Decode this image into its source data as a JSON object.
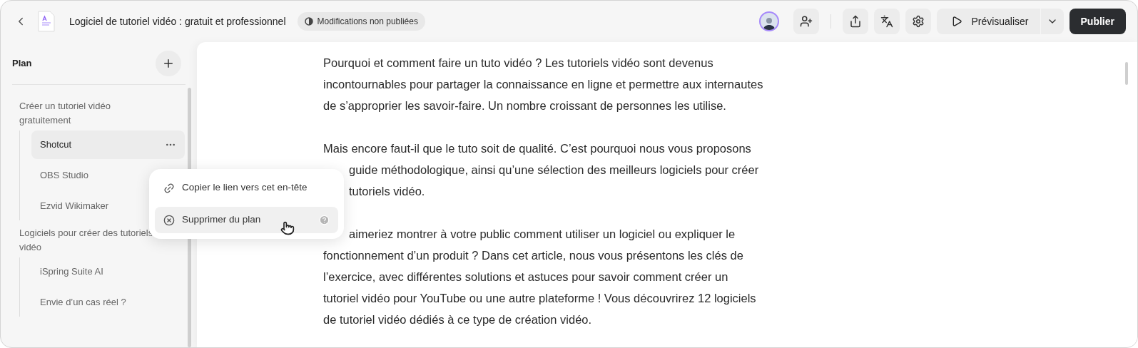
{
  "header": {
    "title": "Logiciel de tutoriel vidéo : gratuit et professionnel",
    "status_badge": "Modifications non publiées",
    "preview_button": "Prévisualiser",
    "publish_button": "Publier"
  },
  "sidebar": {
    "title": "Plan",
    "sections": [
      {
        "label": "Créer un tutoriel vidéo gratuitement",
        "children": [
          {
            "label": "Shotcut",
            "selected": true
          },
          {
            "label": "OBS Studio",
            "selected": false
          },
          {
            "label": "Ezvid Wikimaker",
            "selected": false
          }
        ]
      },
      {
        "label": "Logiciels pour créer des tutoriels vidéo",
        "children": [
          {
            "label": "iSpring Suite AI",
            "selected": false
          },
          {
            "label": "Envie d’un cas réel ?",
            "selected": false
          }
        ]
      }
    ]
  },
  "context_menu": {
    "items": [
      {
        "kind": "link",
        "label": "Copier le lien vers cet en-tête",
        "selected": false
      },
      {
        "kind": "remove",
        "label": "Supprimer du plan",
        "selected": true
      }
    ]
  },
  "article": {
    "paragraphs": [
      {
        "lines": [
          {
            "kind": "full",
            "text": "Pourquoi et comment faire un tuto vidéo ? Les tutoriels vidéo sont devenus"
          },
          {
            "kind": "full",
            "text": "incontournables pour partager la connaissance en ligne et permettre aux internautes"
          },
          {
            "kind": "full",
            "text": "de s’approprier les savoir-faire. Un nombre croissant de personnes les utilise."
          }
        ]
      },
      {
        "lines": [
          {
            "kind": "full",
            "text": "Mais encore faut-il que le tuto soit de qualité. C’est pourquoi nous vous proposons"
          },
          {
            "kind": "covered",
            "text": "guide méthodologique, ainsi qu’une sélection des meilleurs logiciels pour créer"
          },
          {
            "kind": "covered",
            "text": "tutoriels vidéo."
          }
        ]
      },
      {
        "lines": [
          {
            "kind": "covered",
            "text": "aimeriez montrer à votre public comment utiliser un logiciel ou expliquer le"
          },
          {
            "kind": "full",
            "text": "fonctionnement d’un produit ? Dans cet article, nous vous présentons les clés de"
          },
          {
            "kind": "full",
            "text": "l’exercice, avec différentes solutions et astuces pour savoir comment créer un"
          },
          {
            "kind": "full",
            "text": "tutoriel vidéo pour YouTube ou une autre plateforme ! Vous découvrirez 12 logiciels"
          },
          {
            "kind": "full",
            "text": "de tutoriel vidéo dédiés à ce type de création vidéo."
          }
        ]
      }
    ]
  }
}
